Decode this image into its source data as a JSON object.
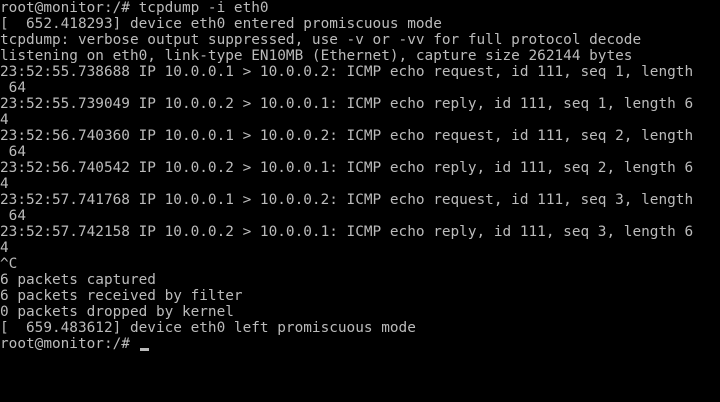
{
  "terminal": {
    "fg_color": "#bbbbbb",
    "bg_color": "#000000",
    "lines": [
      "root@monitor:/# tcpdump -i eth0",
      "[  652.418293] device eth0 entered promiscuous mode",
      "tcpdump: verbose output suppressed, use -v or -vv for full protocol decode",
      "listening on eth0, link-type EN10MB (Ethernet), capture size 262144 bytes",
      "23:52:55.738688 IP 10.0.0.1 > 10.0.0.2: ICMP echo request, id 111, seq 1, length",
      " 64",
      "23:52:55.739049 IP 10.0.0.2 > 10.0.0.1: ICMP echo reply, id 111, seq 1, length 6",
      "4",
      "23:52:56.740360 IP 10.0.0.1 > 10.0.0.2: ICMP echo request, id 111, seq 2, length",
      " 64",
      "23:52:56.740542 IP 10.0.0.2 > 10.0.0.1: ICMP echo reply, id 111, seq 2, length 6",
      "4",
      "23:52:57.741768 IP 10.0.0.1 > 10.0.0.2: ICMP echo request, id 111, seq 3, length",
      " 64",
      "23:52:57.742158 IP 10.0.0.2 > 10.0.0.1: ICMP echo reply, id 111, seq 3, length 6",
      "4",
      "^C",
      "6 packets captured",
      "6 packets received by filter",
      "0 packets dropped by kernel",
      "[  659.483612] device eth0 left promiscuous mode"
    ],
    "prompt": "root@monitor:/# "
  }
}
